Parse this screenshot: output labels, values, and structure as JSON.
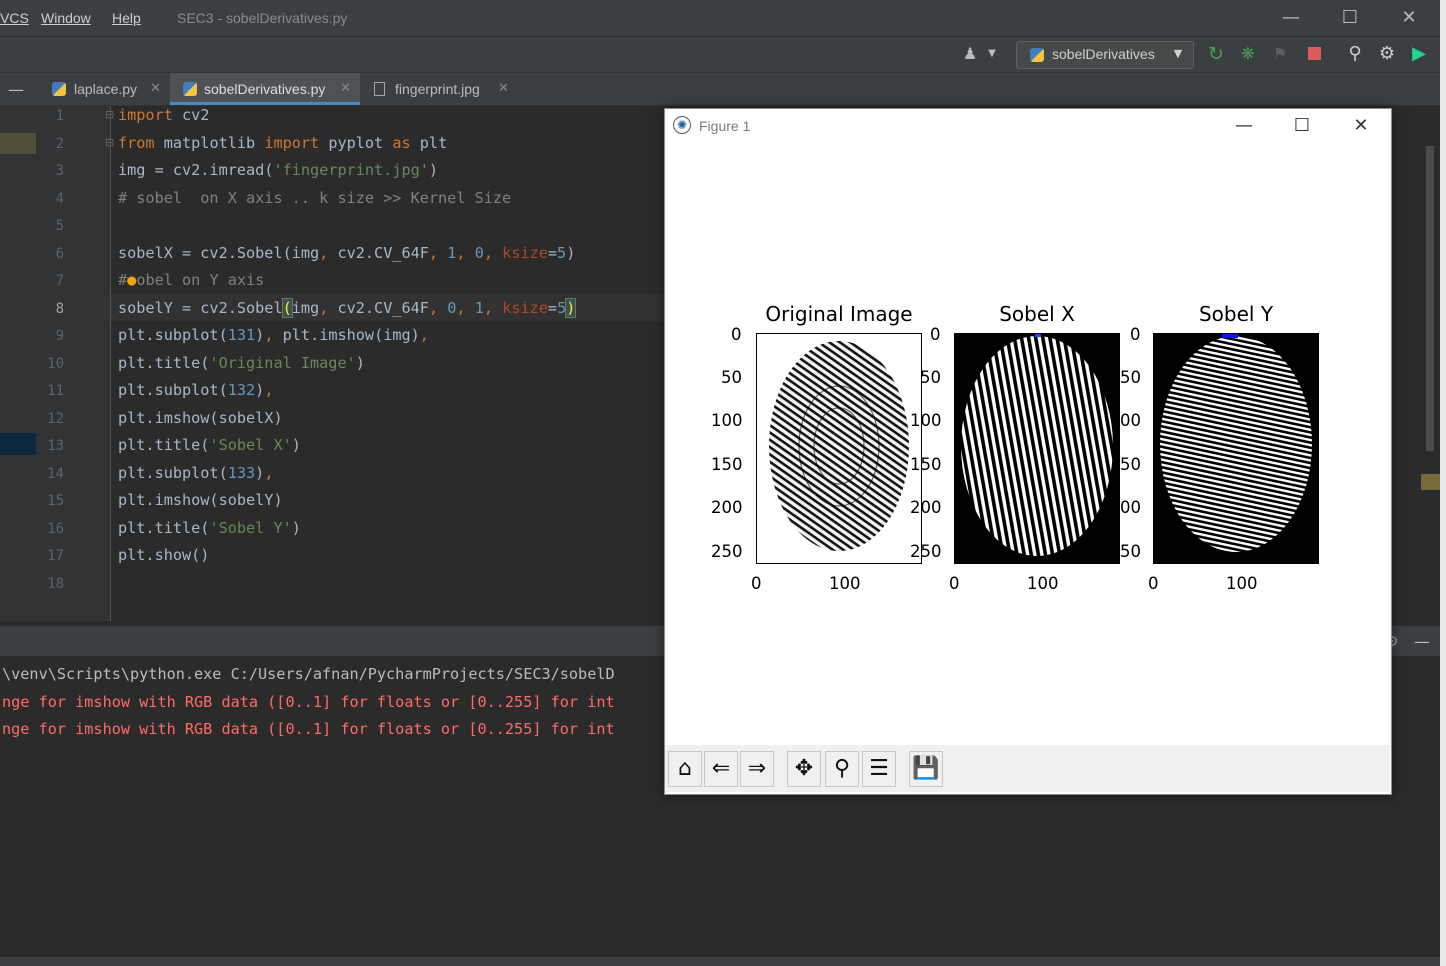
{
  "menu": {
    "vcs": "VCS",
    "window": "Window",
    "help": "Help"
  },
  "window_title": "SEC3 - sobelDerivatives.py",
  "toolbar": {
    "run_config": "sobelDerivatives"
  },
  "tabs": [
    {
      "label": "laplace.py",
      "active": false
    },
    {
      "label": "sobelDerivatives.py",
      "active": true
    },
    {
      "label": "fingerprint.jpg",
      "active": false
    }
  ],
  "editor": {
    "line_numbers": [
      "1",
      "2",
      "3",
      "4",
      "5",
      "6",
      "7",
      "8",
      "9",
      "10",
      "11",
      "12",
      "13",
      "14",
      "15",
      "16",
      "17",
      "18"
    ],
    "current_line": 8
  },
  "run_output": {
    "cmd": "\\venv\\Scripts\\python.exe C:/Users/afnan/PycharmProjects/SEC3/sobelD",
    "warn1": "nge for imshow with RGB data ([0..1] for floats or [0..255] for int",
    "warn2": "nge for imshow with RGB data ([0..1] for floats or [0..255] for int"
  },
  "figure": {
    "title": "Figure 1",
    "subplots": [
      {
        "title": "Original Image",
        "yticks": [
          "0",
          "50",
          "100",
          "150",
          "200",
          "250"
        ],
        "xticks": [
          "0",
          "100"
        ]
      },
      {
        "title": "Sobel X",
        "yticks": [
          "0",
          "50",
          "100",
          "150",
          "200",
          "250"
        ],
        "xticks": [
          "0",
          "100"
        ]
      },
      {
        "title": "Sobel Y",
        "yticks": [
          "0",
          "50",
          "00",
          "50",
          "00",
          "50"
        ],
        "xticks": [
          "0",
          "100"
        ]
      }
    ],
    "toolbar_icons": [
      "home-icon",
      "back-icon",
      "forward-icon",
      "pan-icon",
      "zoom-icon",
      "configure-icon",
      "save-icon"
    ]
  },
  "colors": {
    "keyword": "#cc7832",
    "string": "#6a8759",
    "number": "#6897bb",
    "comment": "#808080",
    "error": "#ff6b68"
  }
}
